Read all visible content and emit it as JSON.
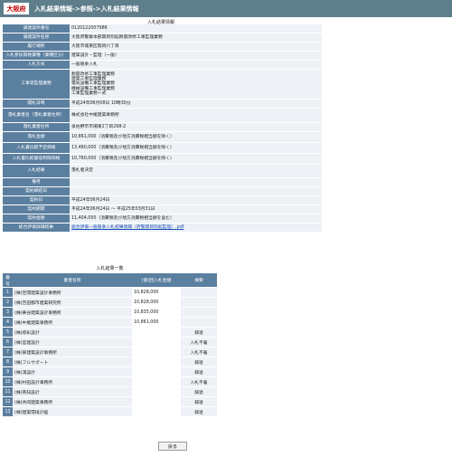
{
  "header": {
    "logo": "大阪府",
    "breadcrumb": "入札結果情報->参照->入札結果情報"
  },
  "info": {
    "title": "入札結果情報",
    "rows": [
      {
        "label": "調達案件番号",
        "value": "0120122007986"
      },
      {
        "label": "調達案件名称",
        "value": "大阪府警察本部関目別館耐震改修工事監理業務"
      },
      {
        "label": "履行場所",
        "value": "大阪市城東区関目六丁目"
      },
      {
        "label": "入札参加資格業種（業種区分）",
        "value": "建築設計・監理（一般）"
      },
      {
        "label": "入札方式",
        "value": "一般競争入札"
      },
      {
        "label": "工事等監理業務",
        "value": "耐震改修工事監理業務\n建築工事監理業務\n電気設備工事監理業務\n機械設備工事監理業務\n工事監理業務一式"
      },
      {
        "label": "開札日時",
        "value": "平成24年06月08日 10時30分"
      },
      {
        "label": "落札業者名（落札業者住所）",
        "value": "株式会社中尾建築事務所"
      },
      {
        "label": "落札業者住所",
        "value": "泉佐野市市場東2丁目298-2"
      },
      {
        "label": "落札金額",
        "value": "10,861,000（消費税及び地方消費税相当額を除く）"
      },
      {
        "label": "入札書比較予定価格",
        "value": "13,480,000（消費税及び地方消費税相当額を除く）"
      },
      {
        "label": "入札書比較最低制限価格",
        "value": "10,760,000（消費税及び地方消費税相当額を除く）"
      },
      {
        "label": "入札結果",
        "value": "落札者決定"
      },
      {
        "label": "備考",
        "value": ""
      },
      {
        "label": "契約締結日",
        "value": ""
      },
      {
        "label": "契約日",
        "value": "平成24年06月24日"
      },
      {
        "label": "契約期間",
        "value": "平成24年06月24日 ～ 平成25年03月31日"
      },
      {
        "label": "契約金額",
        "value": "11,404,050（消費税及び地方消費税相当額を含む）"
      },
      {
        "label": "総合評価詳細結果",
        "value": "総合評価一般競争入札結果情報（府警関目別館監理）.pdf",
        "link": true
      }
    ]
  },
  "bidders": {
    "title": "入札結果一覧",
    "columns": [
      "番号",
      "業者名称",
      "(第)回入札金額",
      "摘要"
    ],
    "rows": [
      {
        "no": "1",
        "name": "(株)空間建築設計事務所",
        "amount": "10,828,000",
        "note": ""
      },
      {
        "no": "2",
        "name": "(株)吉田都市建築研究所",
        "amount": "10,828,000",
        "note": ""
      },
      {
        "no": "3",
        "name": "(株)栗谷建築設計事務所",
        "amount": "10,835,000",
        "note": ""
      },
      {
        "no": "4",
        "name": "(株)中尾建築事務所",
        "amount": "10,861,000",
        "note": ""
      },
      {
        "no": "5",
        "name": "(株)綜彩設計",
        "amount": "",
        "note": "辞退"
      },
      {
        "no": "6",
        "name": "(株)宮建設計",
        "amount": "",
        "note": "入札不着"
      },
      {
        "no": "7",
        "name": "(株)東建築設計事務所",
        "amount": "",
        "note": "入札不着"
      },
      {
        "no": "8",
        "name": "(株)フルサポート",
        "amount": "",
        "note": "辞退"
      },
      {
        "no": "9",
        "name": "(株)鴻設計",
        "amount": "",
        "note": "辞退"
      },
      {
        "no": "10",
        "name": "(株)村田設計事務所",
        "amount": "",
        "note": "入札不着"
      },
      {
        "no": "11",
        "name": "(株)英知設計",
        "amount": "",
        "note": "辞退"
      },
      {
        "no": "12",
        "name": "(株)共同建築事務所",
        "amount": "",
        "note": "辞退"
      },
      {
        "no": "13",
        "name": "(株)建築環境計画",
        "amount": "",
        "note": "辞退"
      }
    ]
  },
  "back_button": "戻る"
}
